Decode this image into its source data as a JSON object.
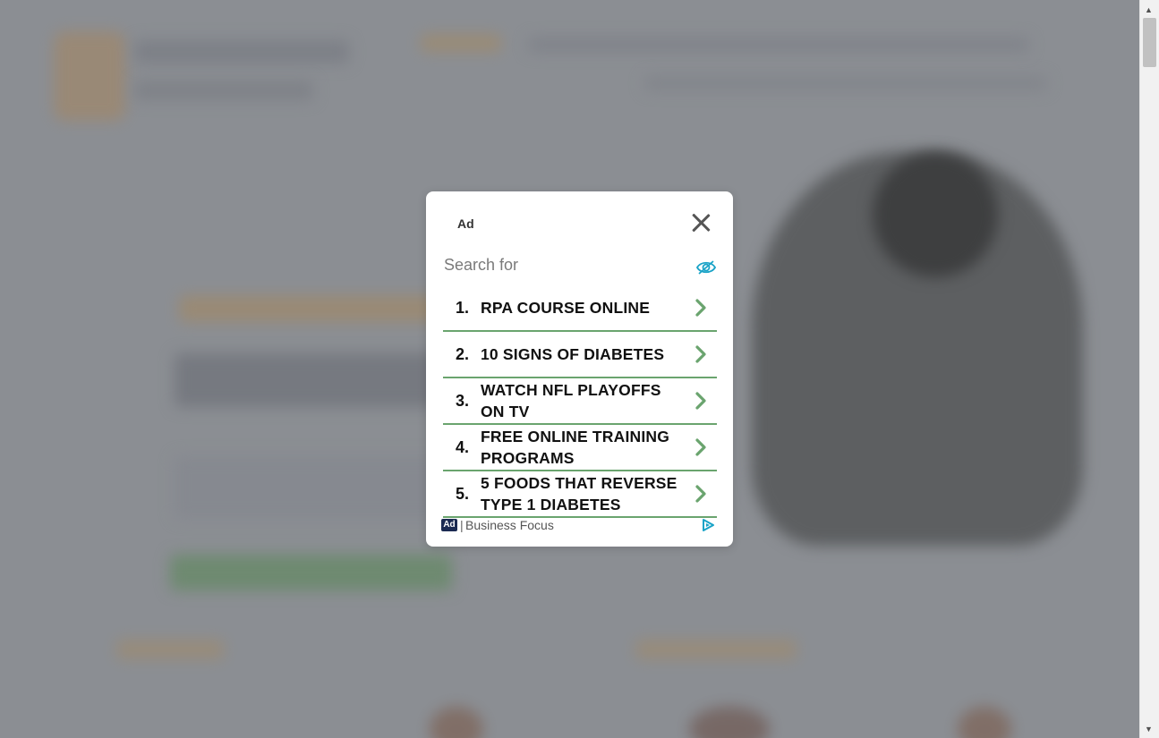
{
  "modal": {
    "ad_label": "Ad",
    "search_for": "Search for",
    "items": [
      {
        "num": "1.",
        "text": "RPA COURSE ONLINE"
      },
      {
        "num": "2.",
        "text": "10 SIGNS OF DIABETES"
      },
      {
        "num": "3.",
        "text": "WATCH NFL PLAYOFFS ON TV"
      },
      {
        "num": "4.",
        "text": "FREE ONLINE TRAINING PROGRAMS"
      },
      {
        "num": "5.",
        "text": "5 FOODS THAT REVERSE TYPE 1 DIABETES"
      }
    ],
    "footer": {
      "badge": "Ad",
      "separator": "|",
      "brand": "Business Focus"
    }
  },
  "icons": {
    "close": "close-icon",
    "hide": "eye-slash-icon",
    "chevron": "chevron-right-icon",
    "adchoices": "adchoices-icon"
  },
  "colors": {
    "overlay": "#8b8e93",
    "divider": "#6aa46e",
    "chevron": "#6aa46e",
    "eye": "#1aa3c7",
    "badge": "#1b2a52"
  }
}
